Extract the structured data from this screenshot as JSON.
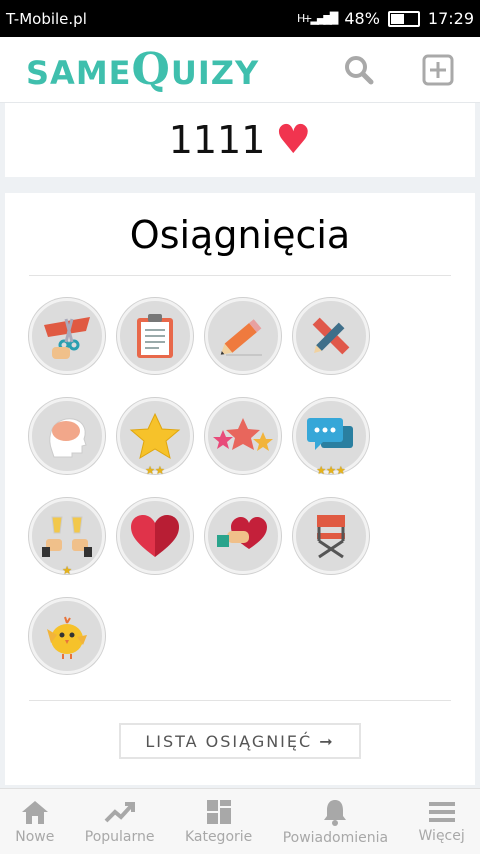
{
  "status": {
    "carrier": "T-Mobile.pl",
    "network": "H+",
    "battery": "48%",
    "time": "17:29"
  },
  "appbar": {
    "logo_left": "SAME",
    "logo_q": "Q",
    "logo_right": "UIZY"
  },
  "likes": {
    "count": "1111"
  },
  "achievements": {
    "title": "Osiągnięcia",
    "rows": [
      [
        {
          "icon": "scissors-ribbon-icon"
        },
        {
          "icon": "clipboard-icon"
        },
        {
          "icon": "pencil-icon"
        },
        {
          "icon": "pencil-ruler-icon"
        }
      ],
      [
        {
          "icon": "brain-head-icon"
        },
        {
          "icon": "star-icon",
          "stars": "★★"
        },
        {
          "icon": "three-stars-icon"
        },
        {
          "icon": "chat-bubbles-icon",
          "stars": "★★★"
        }
      ],
      [
        {
          "icon": "toast-glasses-icon",
          "stars": "★"
        },
        {
          "icon": "heart-icon"
        },
        {
          "icon": "hand-heart-icon"
        },
        {
          "icon": "director-chair-icon"
        }
      ],
      [
        {
          "icon": "chick-icon"
        }
      ]
    ],
    "list_button": "LISTA OSIĄGNIĘĆ ➞"
  },
  "bottom_nav": [
    "Nowe",
    "Popularne",
    "Kategorie",
    "Powiadomienia",
    "Więcej"
  ]
}
